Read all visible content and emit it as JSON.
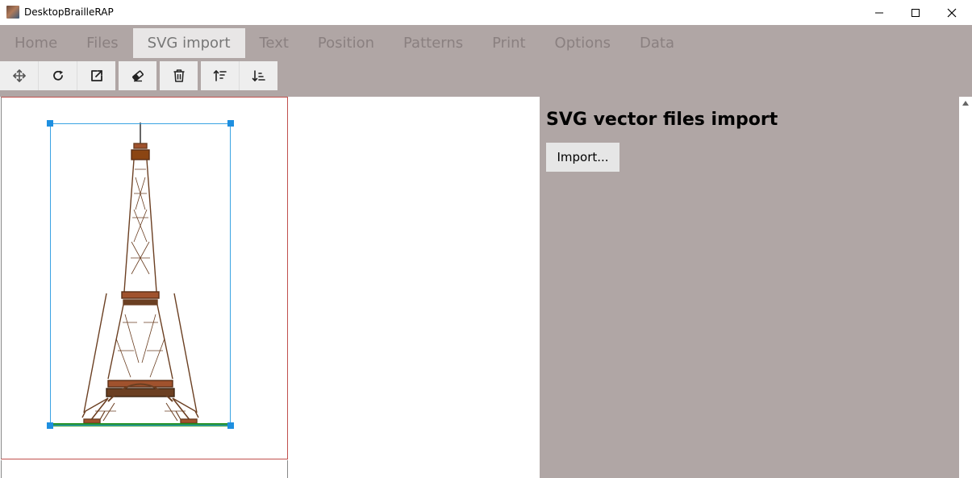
{
  "window": {
    "title": "DesktopBrailleRAP",
    "icon": "app-icon",
    "controls": [
      "minimize-icon",
      "maximize-icon",
      "close-icon"
    ]
  },
  "tabs": [
    {
      "label": "Home",
      "active": false
    },
    {
      "label": "Files",
      "active": false
    },
    {
      "label": "SVG import",
      "active": true
    },
    {
      "label": "Text",
      "active": false
    },
    {
      "label": "Position",
      "active": false
    },
    {
      "label": "Patterns",
      "active": false
    },
    {
      "label": "Print",
      "active": false
    },
    {
      "label": "Options",
      "active": false
    },
    {
      "label": "Data",
      "active": false
    }
  ],
  "toolbar": {
    "groups": [
      [
        "move-icon",
        "rotate-icon",
        "open-external-icon"
      ],
      [
        "eraser-icon"
      ],
      [
        "trash-icon"
      ],
      [
        "sort-ascending-icon",
        "sort-descending-icon"
      ]
    ]
  },
  "canvas": {
    "image": "eiffel-tower-svg",
    "selection_color": "#3aa3e3",
    "page_border_color": "#c0504d"
  },
  "panel": {
    "title": "SVG vector files import",
    "import_label": "Import..."
  },
  "colors": {
    "ribbon_bg": "#b0a6a5",
    "active_tab_bg": "#e8e6e6",
    "tab_text": "#8a8080"
  }
}
